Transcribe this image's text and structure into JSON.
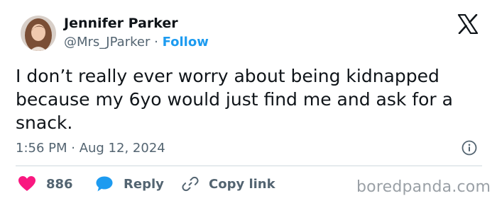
{
  "author": {
    "name": "Jennifer Parker",
    "handle": "@Mrs_JParker",
    "separator": "·",
    "follow_label": "Follow"
  },
  "tweet": {
    "text": "I don’t really ever worry about being kidnapped because my 6yo would just find me and ask for a snack.",
    "timestamp": "1:56 PM · Aug 12, 2024"
  },
  "actions": {
    "like_count": "886",
    "reply_label": "Reply",
    "copy_label": "Copy link"
  },
  "icons": {
    "brand": "x-logo-icon",
    "info": "info-icon",
    "like": "heart-icon",
    "reply": "speech-bubble-icon",
    "copy": "link-icon"
  },
  "colors": {
    "accent": "#1d9bf0",
    "like": "#f91880",
    "text": "#0f1419",
    "muted": "#536471"
  },
  "watermark": "boredpanda.com"
}
